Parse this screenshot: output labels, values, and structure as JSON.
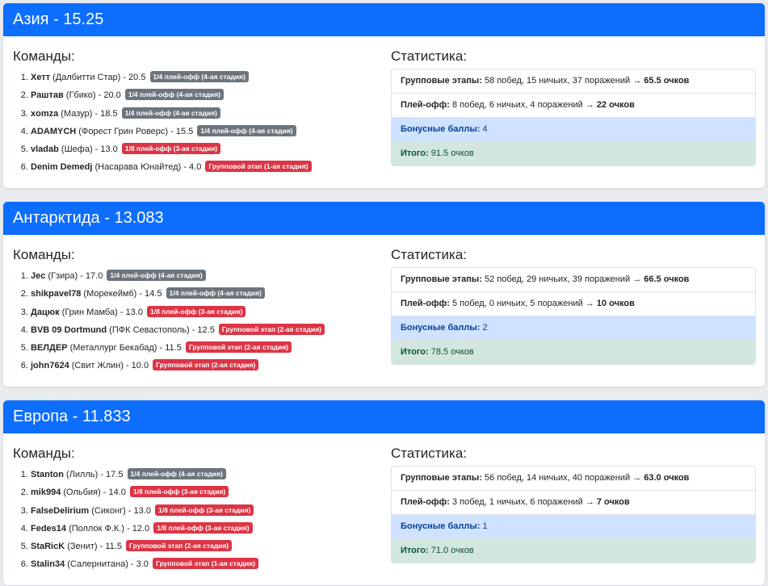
{
  "labels": {
    "teams_title": "Команды:",
    "stats_title": "Статистика:",
    "group_label": "Групповые этапы:",
    "playoff_label": "Плей-офф:",
    "bonus_label": "Бонусные баллы:",
    "total_label": "Итого:"
  },
  "colors": {
    "header": "#0d6efd",
    "badge_playoff": "#6c757d",
    "badge_other": "#dc3545",
    "bonus_bg": "#cfe2ff",
    "total_bg": "#d1e7dd"
  },
  "regions": [
    {
      "title": "Азия - 15.25",
      "teams": [
        {
          "name": "Хетт",
          "club": " (Далбитти Стар) - 20.5",
          "badge": "1/4 плей-офф (4-ая стадия)",
          "badge_type": "playoff"
        },
        {
          "name": "Раштав",
          "club": " (Гбико) - 20.0",
          "badge": "1/4 плей-офф (4-ая стадия)",
          "badge_type": "playoff"
        },
        {
          "name": "xomza",
          "club": " (Мазур) - 18.5",
          "badge": "1/4 плей-офф (4-ая стадия)",
          "badge_type": "playoff"
        },
        {
          "name": "ADAMYCH",
          "club": " (Форест Грин Роверс) - 15.5",
          "badge": "1/4 плей-офф (4-ая стадия)",
          "badge_type": "playoff"
        },
        {
          "name": "vladab",
          "club": " (Шефа) - 13.0",
          "badge": "1/8 плей-офф (3-ая стадия)",
          "badge_type": "other"
        },
        {
          "name": "Denim Demedj",
          "club": " (Насарава Юнайтед) - 4.0",
          "badge": "Групповой этап (1-ая стадия)",
          "badge_type": "other"
        }
      ],
      "stats": {
        "group": " 58 побед, 15 ничьих, 37 поражений → ",
        "group_points": "65.5 очков",
        "playoff": " 8 побед, 6 ничьих, 4 поражений → ",
        "playoff_points": "22 очков",
        "bonus": " 4",
        "total": " 91.5 очков"
      }
    },
    {
      "title": "Антарктида - 13.083",
      "teams": [
        {
          "name": "Jec",
          "club": " (Гзира) - 17.0",
          "badge": "1/4 плей-офф (4-ая стадия)",
          "badge_type": "playoff"
        },
        {
          "name": "shikpavel78",
          "club": " (Морекейм6) - 14.5",
          "badge": "1/4 плей-офф (4-ая стадия)",
          "badge_type": "playoff"
        },
        {
          "name": "Дацюк",
          "club": " (Грин Мамба) - 13.0",
          "badge": "1/8 плей-офф (3-ая стадия)",
          "badge_type": "other"
        },
        {
          "name": "BVB 09 Dortmund",
          "club": " (ПФК Севастополь) - 12.5",
          "badge": "Групповой этап (2-ая стадия)",
          "badge_type": "other"
        },
        {
          "name": "ВЕЛДЕР",
          "club": " (Металлург Бекабад) - 11.5",
          "badge": "Групповой этап (2-ая стадия)",
          "badge_type": "other"
        },
        {
          "name": "john7624",
          "club": " (Свит Жлин) - 10.0",
          "badge": "Групповой этап (2-ая стадия)",
          "badge_type": "other"
        }
      ],
      "stats": {
        "group": " 52 побед, 29 ничьих, 39 поражений → ",
        "group_points": "66.5 очков",
        "playoff": " 5 побед, 0 ничьих, 5 поражений → ",
        "playoff_points": "10 очков",
        "bonus": " 2",
        "total": " 78.5 очков"
      }
    },
    {
      "title": "Европа - 11.833",
      "teams": [
        {
          "name": "Stanton",
          "club": " (Лилль) - 17.5",
          "badge": "1/4 плей-офф (4-ая стадия)",
          "badge_type": "playoff"
        },
        {
          "name": "mik994",
          "club": " (Ольбия) - 14.0",
          "badge": "1/8 плей-офф (3-ая стадия)",
          "badge_type": "other"
        },
        {
          "name": "FalseDelirium",
          "club": " (Сиконг) - 13.0",
          "badge": "1/8 плей-офф (3-ая стадия)",
          "badge_type": "other"
        },
        {
          "name": "Fedes14",
          "club": " (Поллок Ф.К.) - 12.0",
          "badge": "1/8 плей-офф (3-ая стадия)",
          "badge_type": "other"
        },
        {
          "name": "StaRicK",
          "club": " (Зенит) - 11.5",
          "badge": "Групповой этап (2-ая стадия)",
          "badge_type": "other"
        },
        {
          "name": "Stalin34",
          "club": " (Салернитана) - 3.0",
          "badge": "Групповой этап (1-ая стадия)",
          "badge_type": "other"
        }
      ],
      "stats": {
        "group": " 56 побед, 14 ничьих, 40 поражений → ",
        "group_points": "63.0 очков",
        "playoff": " 3 побед, 1 ничьих, 6 поражений → ",
        "playoff_points": "7 очков",
        "bonus": " 1",
        "total": " 71.0 очков"
      }
    }
  ]
}
